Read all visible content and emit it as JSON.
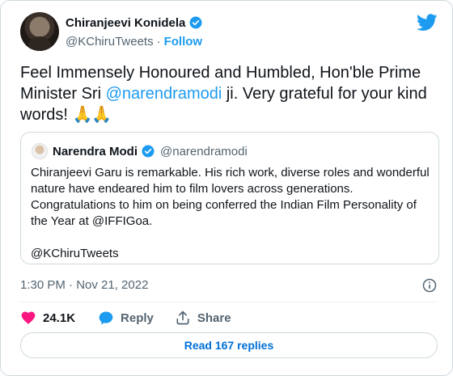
{
  "colors": {
    "accent": "#1d9bf0",
    "like": "#f91880",
    "muted": "#536471",
    "text": "#0f1419"
  },
  "author": {
    "name": "Chiranjeevi Konidela",
    "handle": "@KChiruTweets",
    "separator": "·",
    "follow_label": "Follow",
    "verified_icon": "verified-badge-icon"
  },
  "tweet": {
    "text_before": "Feel Immensely Honoured and Humbled, Hon'ble Prime Minister Sri ",
    "mention": "@narendramodi",
    "text_after": " ji. Very grateful for your kind words! ",
    "emoji": "🙏🙏"
  },
  "quoted": {
    "name": "Narendra Modi",
    "handle": "@narendramodi",
    "text": "Chiranjeevi Garu is remarkable. His rich work, diverse roles and wonderful nature have endeared him to film lovers across generations. Congratulations to him on being conferred the Indian Film Personality of the Year at @IFFIGoa.",
    "signoff": "@KChiruTweets"
  },
  "timestamp": "1:30 PM · Nov 21, 2022",
  "actions": {
    "likes": "24.1K",
    "reply_label": "Reply",
    "share_label": "Share"
  },
  "read_replies_label": "Read 167 replies"
}
